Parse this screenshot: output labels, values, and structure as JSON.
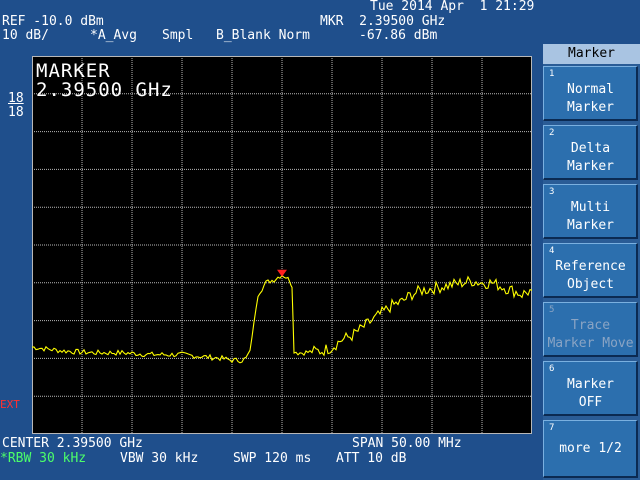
{
  "header": {
    "datetime": "Tue 2014 Apr  1 21:29",
    "ref": "REF -10.0 dBm",
    "scale": "10 dB/",
    "trace_mode": "*A_Avg",
    "detector": "Smpl",
    "trace_b": "B_Blank Norm",
    "marker_freq": "MKR  2.39500 GHz",
    "marker_level": "-67.86 dBm"
  },
  "screen": {
    "marker_label": "MARKER",
    "marker_value": "2.39500 GHz",
    "avg_count_top": "18",
    "avg_count_bottom": "18",
    "ext_label": "EXT"
  },
  "footer": {
    "center": "CENTER 2.39500 GHz",
    "span": "SPAN 50.00 MHz",
    "rbw": "*RBW 30 kHz",
    "vbw": "VBW 30 kHz",
    "sweep": "SWP 120 ms",
    "atten": "ATT 10 dB"
  },
  "menu": {
    "title": "Marker",
    "keys": [
      {
        "num": "1",
        "line1": "Normal",
        "line2": "Marker"
      },
      {
        "num": "2",
        "line1": "Delta",
        "line2": "Marker"
      },
      {
        "num": "3",
        "line1": "Multi",
        "line2": "Marker"
      },
      {
        "num": "4",
        "line1": "Reference",
        "line2": "Object"
      },
      {
        "num": "5",
        "line1": "Trace",
        "line2": "Marker Move"
      },
      {
        "num": "6",
        "line1": "Marker",
        "line2": "OFF"
      },
      {
        "num": "7",
        "line1": "more 1/2"
      }
    ]
  },
  "chart_data": {
    "type": "line",
    "xlabel": "",
    "ylabel": "",
    "x_units": "MHz offset from center",
    "xlim": [
      -25,
      25
    ],
    "ylim": [
      -110,
      -10
    ],
    "grid": true,
    "series": [
      {
        "x": [
          -25,
          -22,
          -19,
          -16,
          -13,
          -10,
          -8,
          -6,
          -5,
          -4,
          -3.6,
          -3.2,
          -2.4,
          -1.6,
          -1.2,
          -0.8,
          -0.4,
          0,
          0.4,
          0.8,
          1.0,
          1.2,
          1.6,
          2,
          4,
          5,
          6,
          7,
          8,
          9,
          10,
          11,
          12,
          13,
          14,
          15,
          16,
          17,
          18,
          19,
          20,
          21,
          22,
          23,
          24,
          25
        ],
        "y": [
          -87,
          -88,
          -88.5,
          -88.5,
          -89,
          -89,
          -89.5,
          -90,
          -90.5,
          -90.5,
          -90,
          -88,
          -73,
          -70,
          -69.5,
          -69.2,
          -68.5,
          -67.86,
          -68.5,
          -69.5,
          -71,
          -88,
          -88.5,
          -88.5,
          -88,
          -87,
          -85,
          -84,
          -82,
          -80,
          -78,
          -76,
          -75,
          -73,
          -72,
          -71.5,
          -71,
          -70.5,
          -70,
          -69.5,
          -70,
          -70,
          -71,
          -72,
          -73,
          -72
        ],
        "color": "#ffff00"
      }
    ],
    "marker": {
      "x": 0,
      "y": -67.86,
      "color": "#ff2020"
    }
  }
}
